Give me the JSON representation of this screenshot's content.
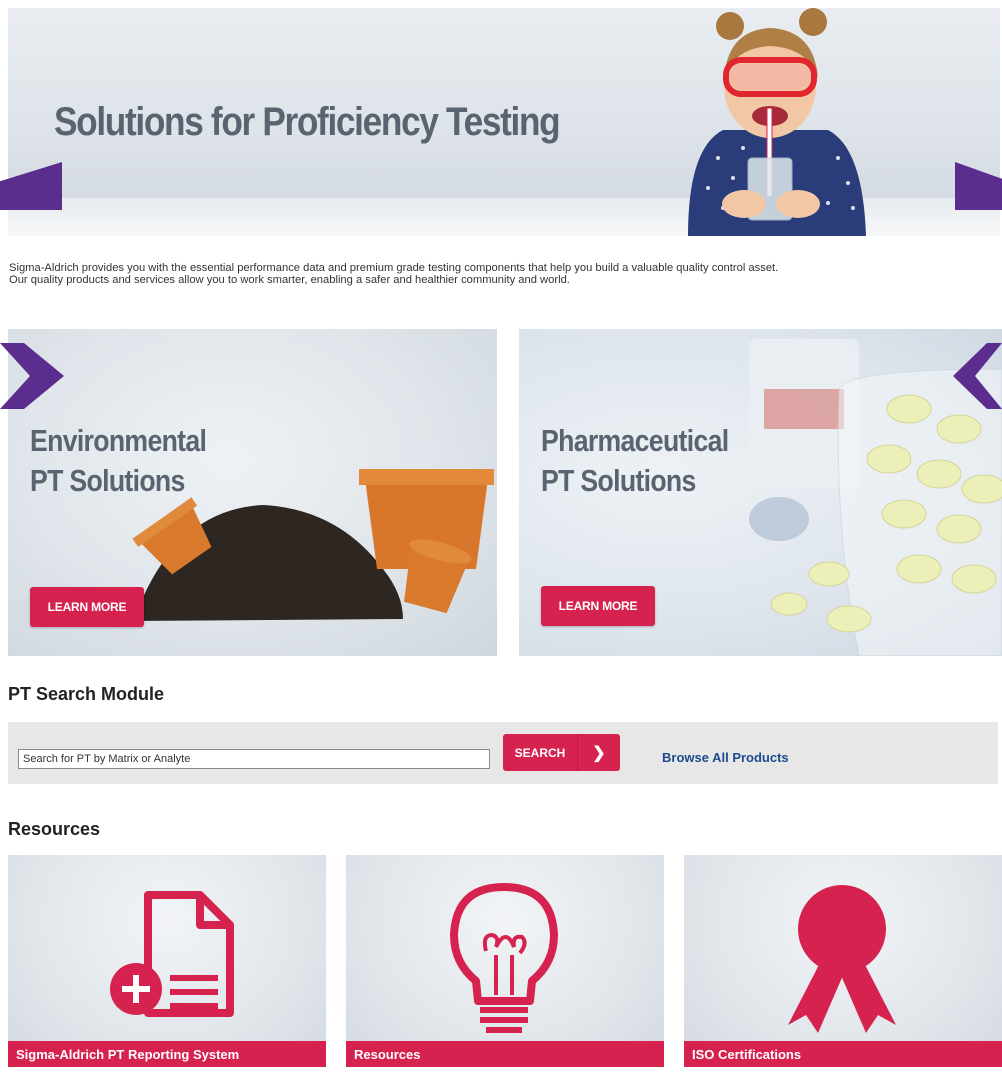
{
  "hero": {
    "title": "Solutions for Proficiency Testing"
  },
  "intro": {
    "line1": "Sigma-Aldrich provides you with the essential performance data and premium grade testing components that help you build a valuable quality control asset.",
    "line2": "Our quality products and services allow you to work smarter, enabling a safer and healthier community and world."
  },
  "tiles": [
    {
      "title": "Environmental\nPT Solutions",
      "button": "LEARN MORE"
    },
    {
      "title": "Pharmaceutical\nPT Solutions",
      "button": "LEARN MORE"
    }
  ],
  "search_module": {
    "heading": "PT Search Module",
    "input_value": "Search for PT by Matrix or Analyte",
    "search_button": "SEARCH",
    "browse_link": "Browse All Products"
  },
  "resources": {
    "heading": "Resources",
    "items": [
      {
        "label": "Sigma-Aldrich PT Reporting System",
        "icon": "document-add-icon"
      },
      {
        "label": "Resources",
        "icon": "lightbulb-icon"
      },
      {
        "label": "ISO Certifications",
        "icon": "ribbon-award-icon"
      }
    ]
  },
  "colors": {
    "accent": "#d6224f",
    "annotation": "#5b2d8e",
    "link": "#1b4b8c",
    "title_gray": "#5a6470"
  }
}
